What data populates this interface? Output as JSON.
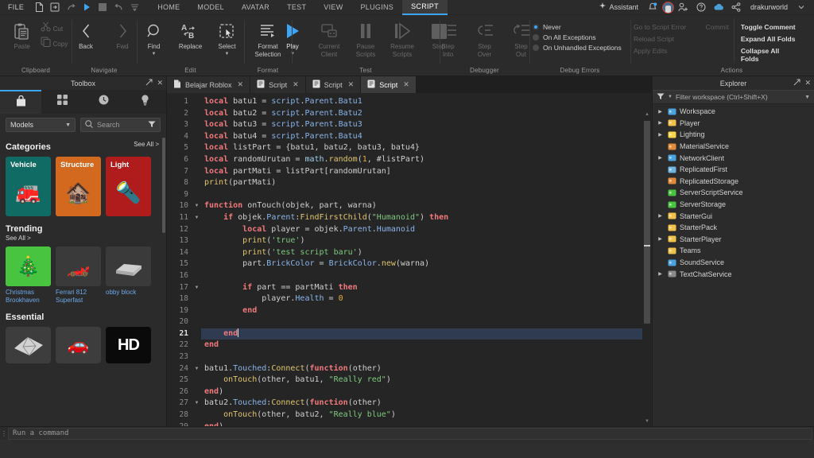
{
  "app": {
    "title": "Roblox Studio"
  },
  "menubar": {
    "file_label": "FILE",
    "quick_icons": [
      "new-document-icon",
      "open-file-icon",
      "redo-icon",
      "play-icon",
      "stop-icon",
      "undo-icon",
      "more-icon"
    ],
    "tabs": [
      {
        "label": "HOME",
        "active": false
      },
      {
        "label": "MODEL",
        "active": false
      },
      {
        "label": "AVATAR",
        "active": false
      },
      {
        "label": "TEST",
        "active": false
      },
      {
        "label": "VIEW",
        "active": false
      },
      {
        "label": "PLUGINS",
        "active": false
      },
      {
        "label": "SCRIPT",
        "active": true
      }
    ],
    "assistant_label": "Assistant",
    "username": "drakurworld",
    "right_icons": [
      "notification-bell-icon",
      "avatar",
      "add-friend-icon",
      "help-icon",
      "cloud-icon",
      "share-icon"
    ]
  },
  "ribbon": {
    "groups": [
      {
        "name": "Clipboard",
        "label": "Clipboard",
        "paste_label": "Paste",
        "cut_label": "Cut",
        "copy_label": "Copy"
      },
      {
        "name": "Navigate",
        "label": "Navigate",
        "buttons": [
          {
            "label": "Back",
            "enabled": true,
            "icon": "chevron-left-icon"
          },
          {
            "label": "Fwd",
            "enabled": false,
            "icon": "chevron-right-icon"
          }
        ]
      },
      {
        "name": "Edit",
        "label": "Edit",
        "buttons": [
          {
            "label": "Find",
            "enabled": true,
            "icon": "magnifier-icon",
            "caret": true
          },
          {
            "label": "Replace",
            "enabled": true,
            "icon": "replace-icon",
            "caret": false
          },
          {
            "label": "Select",
            "enabled": true,
            "icon": "select-icon",
            "caret": true
          }
        ]
      },
      {
        "name": "Format",
        "label": "Format",
        "buttons": [
          {
            "label": "Format\nSelection",
            "enabled": true,
            "icon": "format-lines-icon",
            "caret": true
          }
        ]
      },
      {
        "name": "Test",
        "label": "Test",
        "buttons": [
          {
            "label": "Play",
            "enabled": true,
            "icon": "play-icon",
            "caret": true
          },
          {
            "label": "Current\nClient",
            "enabled": false,
            "icon": "client-icon",
            "caret": false
          },
          {
            "label": "Pause\nScripts",
            "enabled": false,
            "icon": "pause-icon",
            "caret": false
          },
          {
            "label": "Resume\nScripts",
            "enabled": false,
            "icon": "resume-icon",
            "caret": false
          },
          {
            "label": "Stop",
            "enabled": false,
            "icon": "stop-icon",
            "caret": false
          }
        ]
      },
      {
        "name": "Debugger",
        "label": "Debugger",
        "buttons": [
          {
            "label": "Step\nInto",
            "enabled": false,
            "icon": "step-into-icon",
            "caret": false
          },
          {
            "label": "Step\nOver",
            "enabled": false,
            "icon": "step-over-icon",
            "caret": false
          },
          {
            "label": "Step\nOut",
            "enabled": false,
            "icon": "step-out-icon",
            "caret": false
          }
        ]
      },
      {
        "name": "Debug Errors",
        "label": "Debug Errors",
        "radios": [
          {
            "label": "Never",
            "selected": true
          },
          {
            "label": "On All Exceptions",
            "selected": false
          },
          {
            "label": "On Unhandled Exceptions",
            "selected": false
          }
        ]
      },
      {
        "name": "Actions",
        "label": "Actions",
        "left_items": [
          {
            "label": "Go to Script Error",
            "enabled": false
          },
          {
            "label": "Reload Script",
            "enabled": false
          },
          {
            "label": "Apply Edits",
            "enabled": false
          }
        ],
        "mid_items": [
          {
            "label": "Commit",
            "enabled": false
          }
        ],
        "right_items": [
          {
            "label": "Toggle Comment",
            "enabled": true
          },
          {
            "label": "Expand All Folds",
            "enabled": true
          },
          {
            "label": "Collapse All Folds",
            "enabled": true
          }
        ]
      }
    ]
  },
  "toolbox": {
    "title": "Toolbox",
    "tabs": [
      {
        "icon": "bag-icon",
        "active": true
      },
      {
        "icon": "grid-icon",
        "active": false
      },
      {
        "icon": "clock-icon",
        "active": false
      },
      {
        "icon": "lightbulb-icon",
        "active": false
      }
    ],
    "filter_value": "Models",
    "search_placeholder": "Search",
    "categories_title": "Categories",
    "see_all": "See All >",
    "categories": [
      {
        "name": "Vehicle",
        "color": "#0f6b63",
        "art": "🚒"
      },
      {
        "name": "Structure",
        "color": "#d2691e",
        "art": "🏚"
      },
      {
        "name": "Light",
        "color": "#b01b1b",
        "art": "🔦"
      }
    ],
    "trending_title": "Trending",
    "trending_see_all": "See All >",
    "trending": [
      {
        "name": "Christmas Brookhaven",
        "bg": "#49c441",
        "art": "🎄"
      },
      {
        "name": "Ferrari 812 Superfast",
        "bg": "#3a3a3a",
        "art": "🏎"
      },
      {
        "name": "obby block",
        "bg": "#3a3a3a",
        "art": "⬜"
      }
    ],
    "essential_title": "Essential",
    "essential": [
      {
        "bg": "#3d3d3d",
        "art": "🪨",
        "label": ""
      },
      {
        "bg": "#3d3d3d",
        "art": "🚗",
        "label": ""
      },
      {
        "bg": "#0a0a0a",
        "art": "HD",
        "label": "HD"
      }
    ]
  },
  "editor": {
    "tabs": [
      {
        "label": "Belajar Roblox",
        "icon": "place-icon",
        "active": false
      },
      {
        "label": "Script",
        "icon": "script-icon",
        "active": false
      },
      {
        "label": "Script",
        "icon": "script-icon",
        "active": false
      },
      {
        "label": "Script",
        "icon": "script-icon",
        "active": true
      }
    ],
    "active_line": 21,
    "total_lines_shown": 29,
    "fold_lines": [
      10,
      11,
      17,
      24,
      27
    ],
    "lines": [
      {
        "n": 1,
        "tokens": [
          [
            "kw",
            "local"
          ],
          [
            "id",
            " batu1 "
          ],
          [
            "op",
            "= "
          ],
          [
            "prop",
            "script"
          ],
          [
            "op",
            "."
          ],
          [
            "prop",
            "Parent"
          ],
          [
            "op",
            "."
          ],
          [
            "prop",
            "Batu1"
          ]
        ]
      },
      {
        "n": 2,
        "tokens": [
          [
            "kw",
            "local"
          ],
          [
            "id",
            " batu2 "
          ],
          [
            "op",
            "= "
          ],
          [
            "prop",
            "script"
          ],
          [
            "op",
            "."
          ],
          [
            "prop",
            "Parent"
          ],
          [
            "op",
            "."
          ],
          [
            "prop",
            "Batu2"
          ]
        ]
      },
      {
        "n": 3,
        "tokens": [
          [
            "kw",
            "local"
          ],
          [
            "id",
            " batu3 "
          ],
          [
            "op",
            "= "
          ],
          [
            "prop",
            "script"
          ],
          [
            "op",
            "."
          ],
          [
            "prop",
            "Parent"
          ],
          [
            "op",
            "."
          ],
          [
            "prop",
            "Batu3"
          ]
        ]
      },
      {
        "n": 4,
        "tokens": [
          [
            "kw",
            "local"
          ],
          [
            "id",
            " batu4 "
          ],
          [
            "op",
            "= "
          ],
          [
            "prop",
            "script"
          ],
          [
            "op",
            "."
          ],
          [
            "prop",
            "Parent"
          ],
          [
            "op",
            "."
          ],
          [
            "prop",
            "Batu4"
          ]
        ]
      },
      {
        "n": 5,
        "tokens": [
          [
            "kw",
            "local"
          ],
          [
            "id",
            " listPart "
          ],
          [
            "op",
            "= {batu1, batu2, batu3, batu4}"
          ]
        ]
      },
      {
        "n": 6,
        "tokens": [
          [
            "kw",
            "local"
          ],
          [
            "id",
            " randomUrutan "
          ],
          [
            "op",
            "= "
          ],
          [
            "glob",
            "math"
          ],
          [
            "op",
            "."
          ],
          [
            "meth",
            "random"
          ],
          [
            "op",
            "("
          ],
          [
            "num",
            "1"
          ],
          [
            "op",
            ", #listPart)"
          ]
        ]
      },
      {
        "n": 7,
        "tokens": [
          [
            "kw",
            "local"
          ],
          [
            "id",
            " partMati "
          ],
          [
            "op",
            "= listPart[randomUrutan]"
          ]
        ]
      },
      {
        "n": 8,
        "tokens": [
          [
            "meth",
            "print"
          ],
          [
            "op",
            "(partMati)"
          ]
        ]
      },
      {
        "n": 9,
        "tokens": []
      },
      {
        "n": 10,
        "tokens": [
          [
            "kw",
            "function"
          ],
          [
            "id",
            " onTouch"
          ],
          [
            "op",
            "(objek, part, warna)"
          ]
        ]
      },
      {
        "n": 11,
        "tokens": [
          [
            "op",
            "    "
          ],
          [
            "kw",
            "if"
          ],
          [
            "id",
            " objek"
          ],
          [
            "op",
            "."
          ],
          [
            "prop",
            "Parent"
          ],
          [
            "op",
            ":"
          ],
          [
            "meth",
            "FindFirstChild"
          ],
          [
            "op",
            "("
          ],
          [
            "str",
            "\"Humanoid\""
          ],
          [
            "op",
            ") "
          ],
          [
            "kw",
            "then"
          ]
        ]
      },
      {
        "n": 12,
        "tokens": [
          [
            "op",
            "        "
          ],
          [
            "kw",
            "local"
          ],
          [
            "id",
            " player "
          ],
          [
            "op",
            "= objek"
          ],
          [
            "op",
            "."
          ],
          [
            "prop",
            "Parent"
          ],
          [
            "op",
            "."
          ],
          [
            "prop",
            "Humanoid"
          ]
        ]
      },
      {
        "n": 13,
        "tokens": [
          [
            "op",
            "        "
          ],
          [
            "meth",
            "print"
          ],
          [
            "op",
            "("
          ],
          [
            "str",
            "'true'"
          ],
          [
            "op",
            ")"
          ]
        ]
      },
      {
        "n": 14,
        "tokens": [
          [
            "op",
            "        "
          ],
          [
            "meth",
            "print"
          ],
          [
            "op",
            "("
          ],
          [
            "str",
            "'test script baru'"
          ],
          [
            "op",
            ")"
          ]
        ]
      },
      {
        "n": 15,
        "tokens": [
          [
            "op",
            "        part"
          ],
          [
            "op",
            "."
          ],
          [
            "prop",
            "BrickColor"
          ],
          [
            "op",
            " = "
          ],
          [
            "prop",
            "BrickColor"
          ],
          [
            "op",
            "."
          ],
          [
            "meth",
            "new"
          ],
          [
            "op",
            "(warna)"
          ]
        ]
      },
      {
        "n": 16,
        "tokens": []
      },
      {
        "n": 17,
        "tokens": [
          [
            "op",
            "        "
          ],
          [
            "kw",
            "if"
          ],
          [
            "op",
            " part == partMati "
          ],
          [
            "kw",
            "then"
          ]
        ]
      },
      {
        "n": 18,
        "tokens": [
          [
            "op",
            "            player"
          ],
          [
            "op",
            "."
          ],
          [
            "prop",
            "Health"
          ],
          [
            "op",
            " = "
          ],
          [
            "num",
            "0"
          ]
        ]
      },
      {
        "n": 19,
        "tokens": [
          [
            "op",
            "        "
          ],
          [
            "kw",
            "end"
          ]
        ]
      },
      {
        "n": 20,
        "tokens": []
      },
      {
        "n": 21,
        "tokens": [
          [
            "op",
            "    "
          ],
          [
            "kw",
            "end"
          ]
        ]
      },
      {
        "n": 22,
        "tokens": [
          [
            "kw",
            "end"
          ]
        ]
      },
      {
        "n": 23,
        "tokens": []
      },
      {
        "n": 24,
        "tokens": [
          [
            "op",
            "batu1"
          ],
          [
            "op",
            "."
          ],
          [
            "prop",
            "Touched"
          ],
          [
            "op",
            ":"
          ],
          [
            "meth",
            "Connect"
          ],
          [
            "op",
            "("
          ],
          [
            "kw",
            "function"
          ],
          [
            "op",
            "(other)"
          ]
        ]
      },
      {
        "n": 25,
        "tokens": [
          [
            "op",
            "    "
          ],
          [
            "meth",
            "onTouch"
          ],
          [
            "op",
            "(other, batu1, "
          ],
          [
            "str",
            "\"Really red\""
          ],
          [
            "op",
            ")"
          ]
        ]
      },
      {
        "n": 26,
        "tokens": [
          [
            "kw",
            "end"
          ],
          [
            "op",
            ")"
          ]
        ]
      },
      {
        "n": 27,
        "tokens": [
          [
            "op",
            "batu2"
          ],
          [
            "op",
            "."
          ],
          [
            "prop",
            "Touched"
          ],
          [
            "op",
            ":"
          ],
          [
            "meth",
            "Connect"
          ],
          [
            "op",
            "("
          ],
          [
            "kw",
            "function"
          ],
          [
            "op",
            "(other)"
          ]
        ]
      },
      {
        "n": 28,
        "tokens": [
          [
            "op",
            "    "
          ],
          [
            "meth",
            "onTouch"
          ],
          [
            "op",
            "(other, batu2, "
          ],
          [
            "str",
            "\"Really blue\""
          ],
          [
            "op",
            ")"
          ]
        ]
      },
      {
        "n": 29,
        "tokens": [
          [
            "kw",
            "end"
          ],
          [
            "op",
            ")"
          ]
        ]
      }
    ]
  },
  "explorer": {
    "title": "Explorer",
    "filter_placeholder": "Filter workspace (Ctrl+Shift+X)",
    "items": [
      {
        "name": "Workspace",
        "arrow": true,
        "icon": "workspace-icon",
        "color": "#4aa3df"
      },
      {
        "name": "Player",
        "arrow": true,
        "icon": "players-icon",
        "color": "#f0c14b"
      },
      {
        "name": "Lighting",
        "arrow": true,
        "icon": "lighting-icon",
        "color": "#f5d64a"
      },
      {
        "name": "MaterialService",
        "arrow": false,
        "icon": "material-service-icon",
        "color": "#e08a3c"
      },
      {
        "name": "NetworkClient",
        "arrow": true,
        "icon": "network-client-icon",
        "color": "#4aa3df"
      },
      {
        "name": "ReplicatedFirst",
        "arrow": false,
        "icon": "replicated-first-icon",
        "color": "#6fb3e0"
      },
      {
        "name": "ReplicatedStorage",
        "arrow": false,
        "icon": "replicated-storage-icon",
        "color": "#e08a3c"
      },
      {
        "name": "ServerScriptService",
        "arrow": false,
        "icon": "server-script-icon",
        "color": "#49c441"
      },
      {
        "name": "ServerStorage",
        "arrow": false,
        "icon": "server-storage-icon",
        "color": "#49c441"
      },
      {
        "name": "StarterGui",
        "arrow": true,
        "icon": "starter-gui-icon",
        "color": "#f0c14b"
      },
      {
        "name": "StarterPack",
        "arrow": false,
        "icon": "starter-pack-icon",
        "color": "#f0c14b"
      },
      {
        "name": "StarterPlayer",
        "arrow": true,
        "icon": "starter-player-icon",
        "color": "#f0c14b"
      },
      {
        "name": "Teams",
        "arrow": false,
        "icon": "teams-icon",
        "color": "#f0c14b"
      },
      {
        "name": "SoundService",
        "arrow": false,
        "icon": "sound-service-icon",
        "color": "#4aa3df"
      },
      {
        "name": "TextChatService",
        "arrow": true,
        "icon": "text-chat-icon",
        "color": "#8a8a8a"
      }
    ]
  },
  "command_bar": {
    "placeholder": "Run a command"
  },
  "colors": {
    "accent": "#3da5f5",
    "ribbon_bg": "#2b2b2b",
    "editor_bg": "#252526",
    "active_line": "#2e3b50",
    "keyword": "#f1797c",
    "string": "#7fc97f",
    "number": "#e8b339",
    "property": "#8ab4e8",
    "method": "#e0c56e"
  }
}
